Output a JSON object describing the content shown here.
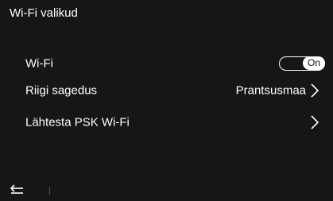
{
  "header": {
    "title": "Wi-Fi valikud"
  },
  "settings": {
    "wifi": {
      "label": "Wi-Fi",
      "toggle_text": "On"
    },
    "country": {
      "label": "Riigi sagedus",
      "value": "Prantsusmaa"
    },
    "reset": {
      "label": "Lähtesta PSK Wi-Fi"
    }
  },
  "icons": {
    "back": "back-arrow-icon",
    "chevron": "chevron-right-icon"
  },
  "colors": {
    "background": "#161616",
    "text": "#ffffff"
  }
}
